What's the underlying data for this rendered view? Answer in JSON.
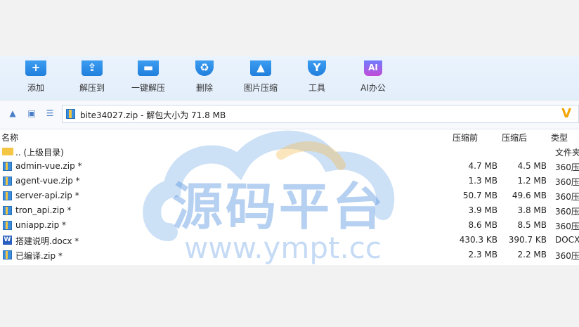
{
  "toolbar": {
    "buttons": [
      {
        "label": "添加",
        "icon": "add-icon",
        "glyph": "+"
      },
      {
        "label": "解压到",
        "icon": "extract-to-icon",
        "glyph": "⇪"
      },
      {
        "label": "一键解压",
        "icon": "one-click-extract-icon",
        "glyph": "▬"
      },
      {
        "label": "删除",
        "icon": "recycle-delete-icon",
        "glyph": "♻"
      },
      {
        "label": "图片压缩",
        "icon": "image-compress-icon",
        "glyph": "▲"
      },
      {
        "label": "工具",
        "icon": "tools-shield-icon",
        "glyph": "Y"
      },
      {
        "label": "AI办公",
        "icon": "ai-office-icon",
        "glyph": "AI"
      }
    ]
  },
  "address": {
    "text": "bite34027.zip - 解包大小为 71.8 MB",
    "arrow": "V"
  },
  "columns": {
    "name": "名称",
    "before": "压缩前",
    "after": "压缩后",
    "type": "类型"
  },
  "files": [
    {
      "name": ".. (上级目录)",
      "before": "",
      "after": "",
      "type": "文件夹",
      "icon": "folder"
    },
    {
      "name": "admin-vue.zip *",
      "before": "4.7 MB",
      "after": "4.5 MB",
      "type": "360压",
      "icon": "zip"
    },
    {
      "name": "agent-vue.zip *",
      "before": "1.3 MB",
      "after": "1.2 MB",
      "type": "360压",
      "icon": "zip"
    },
    {
      "name": "server-api.zip *",
      "before": "50.7 MB",
      "after": "49.6 MB",
      "type": "360压",
      "icon": "zip"
    },
    {
      "name": "tron_api.zip *",
      "before": "3.9 MB",
      "after": "3.8 MB",
      "type": "360压",
      "icon": "zip"
    },
    {
      "name": "uniapp.zip *",
      "before": "8.6 MB",
      "after": "8.5 MB",
      "type": "360压",
      "icon": "zip"
    },
    {
      "name": "搭建说明.docx *",
      "before": "430.3 KB",
      "after": "390.7 KB",
      "type": "DOCX",
      "icon": "doc"
    },
    {
      "name": "已编译.zip *",
      "before": "2.3 MB",
      "after": "2.2 MB",
      "type": "360压",
      "icon": "zip"
    }
  ],
  "watermark": {
    "title": "源码平台",
    "url": "www.ympt.cc"
  }
}
